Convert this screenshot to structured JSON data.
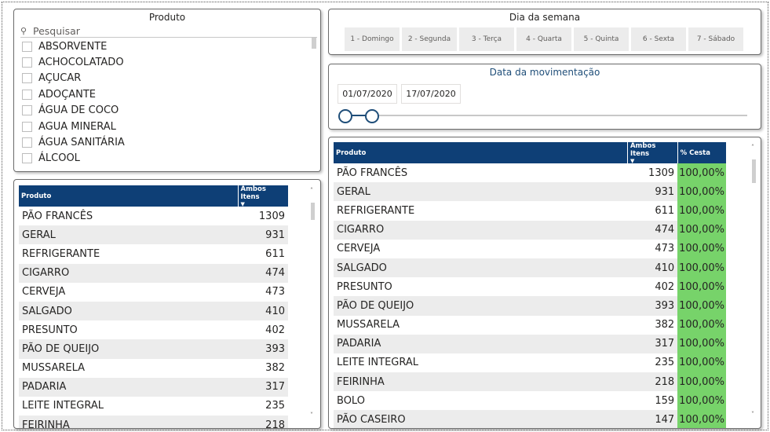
{
  "produto_slicer": {
    "title": "Produto",
    "search_placeholder": "Pesquisar",
    "items": [
      "ABSORVENTE",
      "ACHOCOLATADO",
      "AÇUCAR",
      "ADOÇANTE",
      "ÁGUA DE COCO",
      "AGUA MINERAL",
      "ÁGUA SANITÁRIA",
      "ÁLCOOL"
    ]
  },
  "dia_slicer": {
    "title": "Dia da semana",
    "days": [
      "1 - Domingo",
      "2 - Segunda",
      "3 - Terça",
      "4 - Quarta",
      "5 - Quinta",
      "6 - Sexta",
      "7 - Sábado"
    ]
  },
  "data_slicer": {
    "title": "Data da movimentação",
    "start": "01/07/2020",
    "end": "17/07/2020"
  },
  "left_table": {
    "headers": {
      "produto": "Produto",
      "ambos": "Ambos Itens"
    },
    "rows": [
      {
        "produto": "PÃO FRANCÊS",
        "ambos": "1309"
      },
      {
        "produto": "GERAL",
        "ambos": "931"
      },
      {
        "produto": "REFRIGERANTE",
        "ambos": "611"
      },
      {
        "produto": "CIGARRO",
        "ambos": "474"
      },
      {
        "produto": "CERVEJA",
        "ambos": "473"
      },
      {
        "produto": "SALGADO",
        "ambos": "410"
      },
      {
        "produto": "PRESUNTO",
        "ambos": "402"
      },
      {
        "produto": "PÃO DE QUEIJO",
        "ambos": "393"
      },
      {
        "produto": "MUSSARELA",
        "ambos": "382"
      },
      {
        "produto": "PADARIA",
        "ambos": "317"
      },
      {
        "produto": "LEITE INTEGRAL",
        "ambos": "235"
      },
      {
        "produto": "FEIRINHA",
        "ambos": "218"
      }
    ]
  },
  "right_table": {
    "headers": {
      "produto": "Produto",
      "ambos": "Ambos Itens",
      "cesta": "% Cesta"
    },
    "rows": [
      {
        "produto": "PÃO FRANCÊS",
        "ambos": "1309",
        "cesta": "100,00%"
      },
      {
        "produto": "GERAL",
        "ambos": "931",
        "cesta": "100,00%"
      },
      {
        "produto": "REFRIGERANTE",
        "ambos": "611",
        "cesta": "100,00%"
      },
      {
        "produto": "CIGARRO",
        "ambos": "474",
        "cesta": "100,00%"
      },
      {
        "produto": "CERVEJA",
        "ambos": "473",
        "cesta": "100,00%"
      },
      {
        "produto": "SALGADO",
        "ambos": "410",
        "cesta": "100,00%"
      },
      {
        "produto": "PRESUNTO",
        "ambos": "402",
        "cesta": "100,00%"
      },
      {
        "produto": "PÃO DE QUEIJO",
        "ambos": "393",
        "cesta": "100,00%"
      },
      {
        "produto": "MUSSARELA",
        "ambos": "382",
        "cesta": "100,00%"
      },
      {
        "produto": "PADARIA",
        "ambos": "317",
        "cesta": "100,00%"
      },
      {
        "produto": "LEITE INTEGRAL",
        "ambos": "235",
        "cesta": "100,00%"
      },
      {
        "produto": "FEIRINHA",
        "ambos": "218",
        "cesta": "100,00%"
      },
      {
        "produto": "BOLO",
        "ambos": "159",
        "cesta": "100,00%"
      },
      {
        "produto": "PÃO CASEIRO",
        "ambos": "147",
        "cesta": "100,00%"
      }
    ]
  },
  "colors": {
    "header_bg": "#0e3f76",
    "bar_green": "#77d36a",
    "accent": "#1f4e79"
  },
  "icons": {
    "search": "search-icon",
    "sort": "sort-down-icon"
  }
}
